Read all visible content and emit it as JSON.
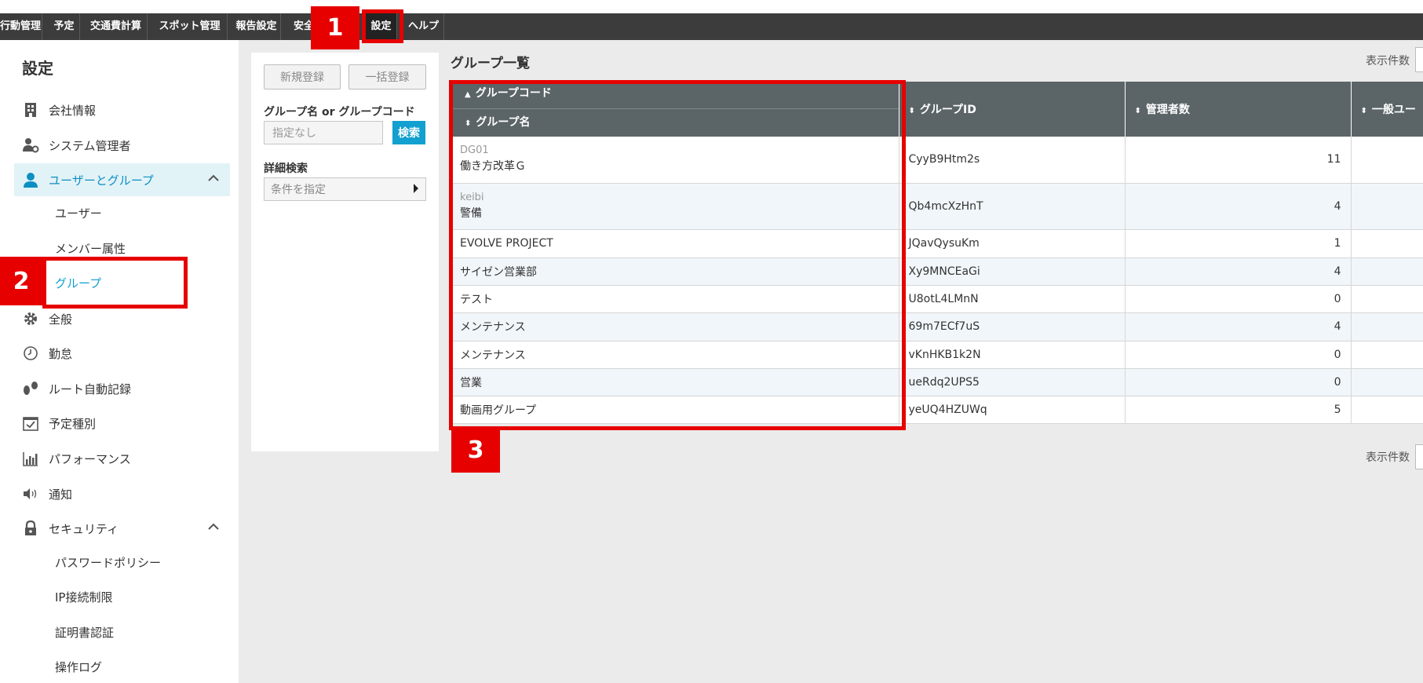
{
  "navbar": {
    "items": [
      {
        "label": "行動管理"
      },
      {
        "label": "予定"
      },
      {
        "label": "交通費計算"
      },
      {
        "label": "スポット管理"
      },
      {
        "label": "報告設定"
      },
      {
        "label": "安全"
      },
      {
        "label": "設定",
        "active": true
      },
      {
        "label": "ヘルプ"
      }
    ]
  },
  "sidebar": {
    "title": "設定",
    "items": [
      {
        "label": "会社情報",
        "icon": "building-icon"
      },
      {
        "label": "システム管理者",
        "icon": "admin-user-icon"
      },
      {
        "label": "ユーザーとグループ",
        "icon": "user-icon",
        "expanded": true
      },
      {
        "label": "全般",
        "icon": "gear-icon"
      },
      {
        "label": "勤怠",
        "icon": "clock-icon"
      },
      {
        "label": "ルート自動記録",
        "icon": "footprints-icon"
      },
      {
        "label": "予定種別",
        "icon": "calendar-check-icon"
      },
      {
        "label": "パフォーマンス",
        "icon": "bar-chart-icon"
      },
      {
        "label": "通知",
        "icon": "speaker-icon"
      },
      {
        "label": "セキュリティ",
        "icon": "lock-icon",
        "expanded": true
      }
    ],
    "user_group_sub": [
      {
        "label": "ユーザー"
      },
      {
        "label": "メンバー属性"
      },
      {
        "label": "グループ",
        "active": true
      }
    ],
    "security_sub": [
      {
        "label": "パスワードポリシー"
      },
      {
        "label": "IP接続制限"
      },
      {
        "label": "証明書認証"
      },
      {
        "label": "操作ログ"
      }
    ]
  },
  "filter": {
    "new_button": "新規登録",
    "bulk_button": "一括登録",
    "search_label": "グループ名 or グループコード",
    "search_placeholder": "指定なし",
    "search_button": "検索",
    "detail_label": "詳細検索",
    "condition_placeholder": "条件を指定"
  },
  "main": {
    "title": "グループ一覧",
    "per_page_label": "表示件数",
    "columns": {
      "group_code": "グループコード",
      "group_name": "グループ名",
      "group_id": "グループID",
      "admin_count": "管理者数",
      "general_users": "一般ユー"
    },
    "rows": [
      {
        "code": "DG01",
        "name": "働き方改革Ｇ",
        "id": "CyyB9Htm2s",
        "admins": "11"
      },
      {
        "code": "keibi",
        "name": "警備",
        "id": "Qb4mcXzHnT",
        "admins": "4"
      },
      {
        "code": "",
        "name": "EVOLVE PROJECT",
        "id": "JQavQysuKm",
        "admins": "1"
      },
      {
        "code": "",
        "name": "サイゼン営業部",
        "id": "Xy9MNCEaGi",
        "admins": "4"
      },
      {
        "code": "",
        "name": "テスト",
        "id": "U8otL4LMnN",
        "admins": "0"
      },
      {
        "code": "",
        "name": "メンテナンス",
        "id": "69m7ECf7uS",
        "admins": "4"
      },
      {
        "code": "",
        "name": "メンテナンス",
        "id": "vKnHKB1k2N",
        "admins": "0"
      },
      {
        "code": "",
        "name": "営業",
        "id": "ueRdq2UPS5",
        "admins": "0"
      },
      {
        "code": "",
        "name": "動画用グループ",
        "id": "yeUQ4HZUWq",
        "admins": "5"
      }
    ]
  },
  "annotations": {
    "label1": "1",
    "label2": "2",
    "label3": "3",
    "color": "#e60000"
  }
}
